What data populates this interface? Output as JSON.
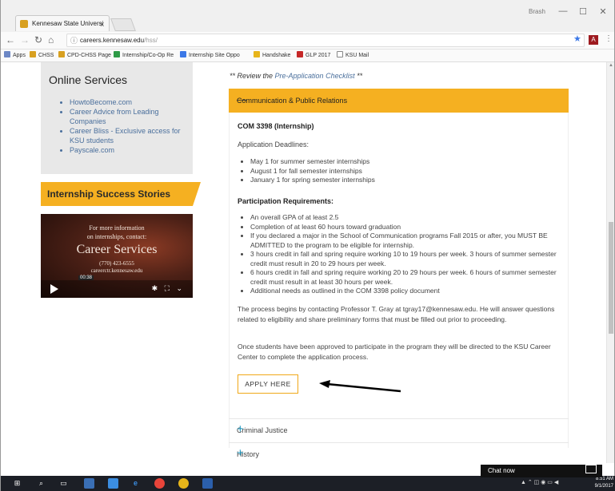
{
  "browser": {
    "tab_title": "Kennesaw State Universi",
    "tab_close": "x",
    "user": "Brash",
    "window_controls": [
      "—",
      "☐",
      "✕"
    ],
    "url_host": "careers.kennesaw.edu",
    "url_path": "/hss/",
    "bookmarks": [
      "Apps",
      "CHSS",
      "CPD-CHSS Page",
      "Internship/Co-Op Re",
      "Internship Site Oppo",
      "Handshake",
      "GLP 2017",
      "KSU Mail"
    ]
  },
  "sidebar": {
    "online_title": "Online Services",
    "online_links": [
      "HowtoBecome.com",
      "Career Advice from Leading Companies",
      "Career Bliss - Exclusive access for KSU students",
      "Payscale.com"
    ],
    "stories_title": "Internship Success Stories",
    "video": {
      "line1": "For more information",
      "line2": "on internships, contact:",
      "heading": "Career Services",
      "phone": "(770) 423-6555",
      "web": "careerctr.kennesaw.edu",
      "time": "00:38"
    }
  },
  "main": {
    "checklist_prefix": "** Review the ",
    "checklist_link": "Pre-Application Checklist",
    "checklist_suffix": " **",
    "open_section": "Communication & Public Relations",
    "open_icon": "—",
    "course_title": "COM 3398 (Internship)",
    "deadlines_label": "Application Deadlines:",
    "deadlines": [
      "May 1 for summer semester internships",
      "August 1 for fall semester internships",
      "January 1 for spring semester internships"
    ],
    "requirements_label": "Participation Requirements:",
    "requirements": [
      "An overall GPA of at least 2.5",
      "Completion of at least 60 hours toward graduation",
      "If you declared a major in the School of Communication programs Fall 2015 or after, you MUST BE ADMITTED to the program to be eligible for internship.",
      "3 hours credit in fall and spring require working 10 to 19 hours per week.  3 hours of summer semester credit must result in 20 to 29 hours per week.",
      "6 hours credit in fall and spring require working 20 to 29 hours per week.  6 hours of summer semester credit must result in at least 30 hours per week.",
      "Additional needs as outlined in the COM 3398 policy document"
    ],
    "para1": "The process begins by contacting Professor T. Gray at tgray17@kennesaw.edu.  He will answer questions related to eligibility and share preliminary forms that must be filled out prior to proceeding.",
    "para2": "Once students have been approved to participate in the program they will be directed to the KSU Career Center to complete the application process.",
    "apply_button": "APPLY HERE",
    "closed_sections": [
      "Criminal Justice",
      "History"
    ],
    "closed_icon": "+"
  },
  "chat": {
    "label": "Chat now"
  },
  "taskbar": {
    "time": "8:51 AM",
    "date": "9/1/2017"
  },
  "colors": {
    "accent": "#f5b021",
    "link": "#4a6f9c",
    "plus": "#2aa1c8"
  }
}
